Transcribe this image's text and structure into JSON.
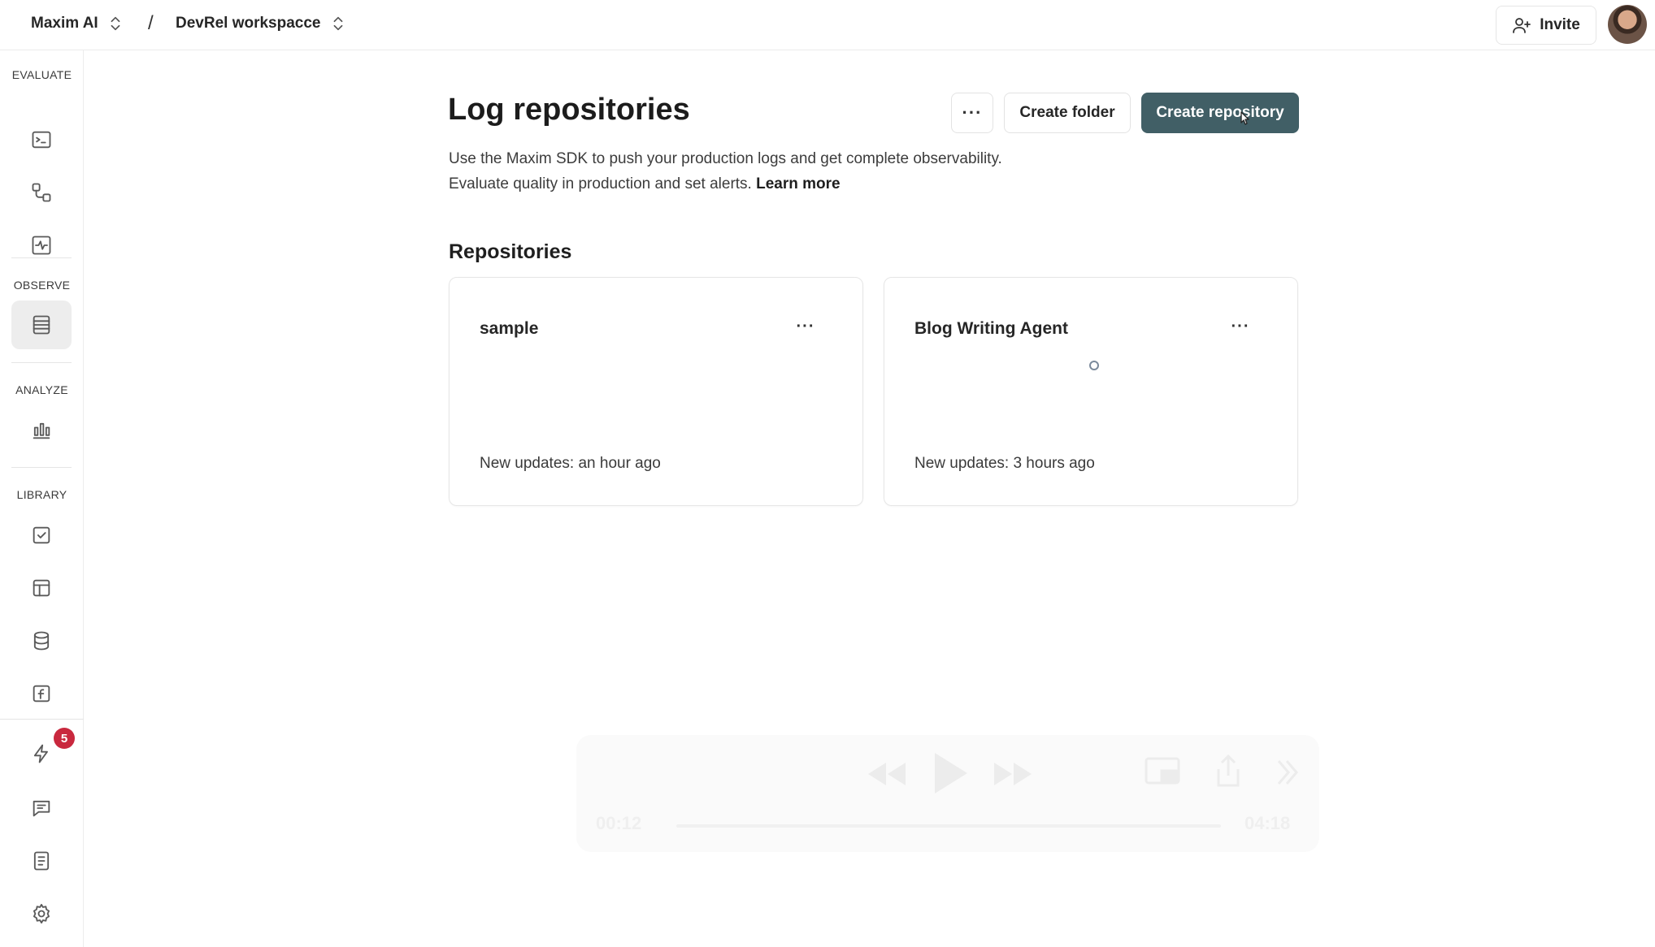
{
  "header": {
    "org_name": "Maxim AI",
    "separator": "/",
    "workspace_name": "DevRel workspacce",
    "invite_label": "Invite"
  },
  "sidebar": {
    "sections": {
      "evaluate": "EVALUATE",
      "observe": "OBSERVE",
      "analyze": "ANALYZE",
      "library": "LIBRARY"
    },
    "notification_count": "5"
  },
  "main": {
    "title": "Log repositories",
    "more_label": "···",
    "create_folder_label": "Create folder",
    "create_repository_label": "Create repository",
    "description_line1": "Use the Maxim SDK to push your production logs and get complete observability.",
    "description_line2": "Evaluate quality in production and set alerts.",
    "learn_more": "Learn more",
    "section_title": "Repositories",
    "repositories": [
      {
        "name": "sample",
        "updated": "New updates: an hour ago",
        "more": "···"
      },
      {
        "name": "Blog Writing Agent",
        "updated": "New updates: 3 hours ago",
        "more": "···"
      }
    ]
  },
  "video_overlay": {
    "current_time": "00:12",
    "total_time": "04:18"
  },
  "colors": {
    "primary_button": "#415f66",
    "badge": "#c9283e",
    "active_nav": "#ededed"
  }
}
